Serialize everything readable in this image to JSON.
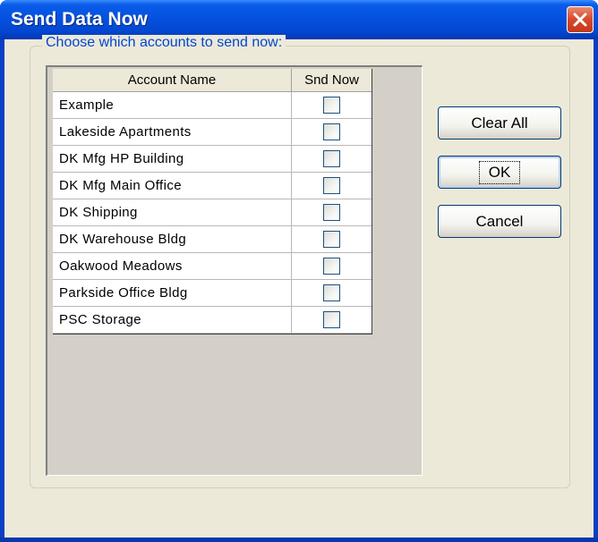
{
  "window": {
    "title": "Send Data Now"
  },
  "group": {
    "label": "Choose which accounts to send now:"
  },
  "table": {
    "columns": [
      "Account Name",
      "Snd Now"
    ],
    "rows": [
      {
        "name": "Example",
        "send": false
      },
      {
        "name": "Lakeside Apartments",
        "send": false
      },
      {
        "name": "DK Mfg HP Building",
        "send": false
      },
      {
        "name": "DK Mfg Main Office",
        "send": false
      },
      {
        "name": "DK Shipping",
        "send": false
      },
      {
        "name": "DK Warehouse Bldg",
        "send": false
      },
      {
        "name": "Oakwood Meadows",
        "send": false
      },
      {
        "name": "Parkside Office Bldg",
        "send": false
      },
      {
        "name": "PSC Storage",
        "send": false
      }
    ]
  },
  "buttons": {
    "clear_all": "Clear All",
    "ok": "OK",
    "cancel": "Cancel"
  },
  "icons": {
    "close": "close-icon",
    "checkbox": "checkbox-icon"
  },
  "colors": {
    "titlebar": "#0551e0",
    "group_label": "#0046d5",
    "dialog_bg": "#ece9d8",
    "close_button": "#d6492b"
  }
}
